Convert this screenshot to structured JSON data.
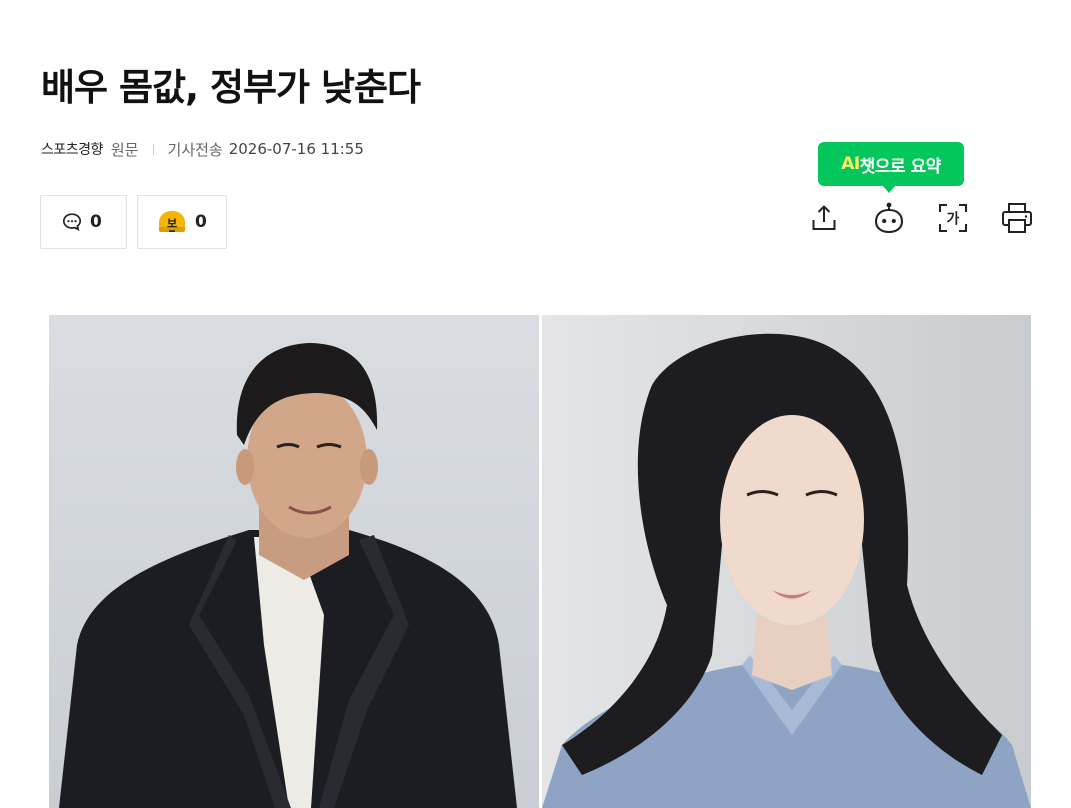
{
  "article": {
    "title": "배우 몸값, 정부가 낮춘다",
    "press": "스포츠경향",
    "original_label": "원문",
    "date_label": "기사전송",
    "date": "2026-07-16 11:55"
  },
  "reactions": {
    "comment_count": "0",
    "like_count": "0"
  },
  "tooltip": {
    "ai_text": "AI",
    "rest_text": "챗으로 요약"
  },
  "toolbar": {
    "icons": [
      "share-icon",
      "ai-chatbot-icon",
      "font-size-icon",
      "print-icon"
    ]
  },
  "colors": {
    "tooltip_bg": "#03c75a",
    "ai_highlight": "#fff06a",
    "like_badge": "#f5b400"
  }
}
